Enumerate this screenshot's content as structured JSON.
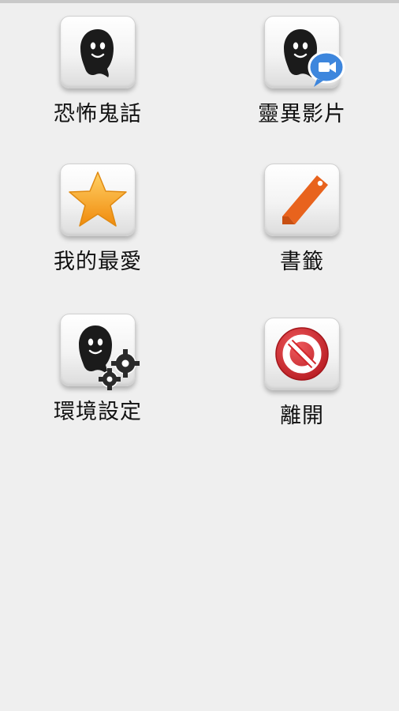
{
  "menu": {
    "items": [
      {
        "label": "恐怖鬼話",
        "icon": "ghost-icon"
      },
      {
        "label": "靈異影片",
        "icon": "ghost-video-icon"
      },
      {
        "label": "我的最愛",
        "icon": "star-icon"
      },
      {
        "label": "書籤",
        "icon": "bookmark-icon"
      },
      {
        "label": "環境設定",
        "icon": "ghost-settings-icon"
      },
      {
        "label": "離開",
        "icon": "exit-icon"
      }
    ]
  },
  "colors": {
    "background": "#efefef",
    "ghost": "#1b1b1b",
    "star": "#f7a51b",
    "bookmark": "#e8631d",
    "exit": "#d3272c",
    "video_badge": "#3d86dd"
  }
}
